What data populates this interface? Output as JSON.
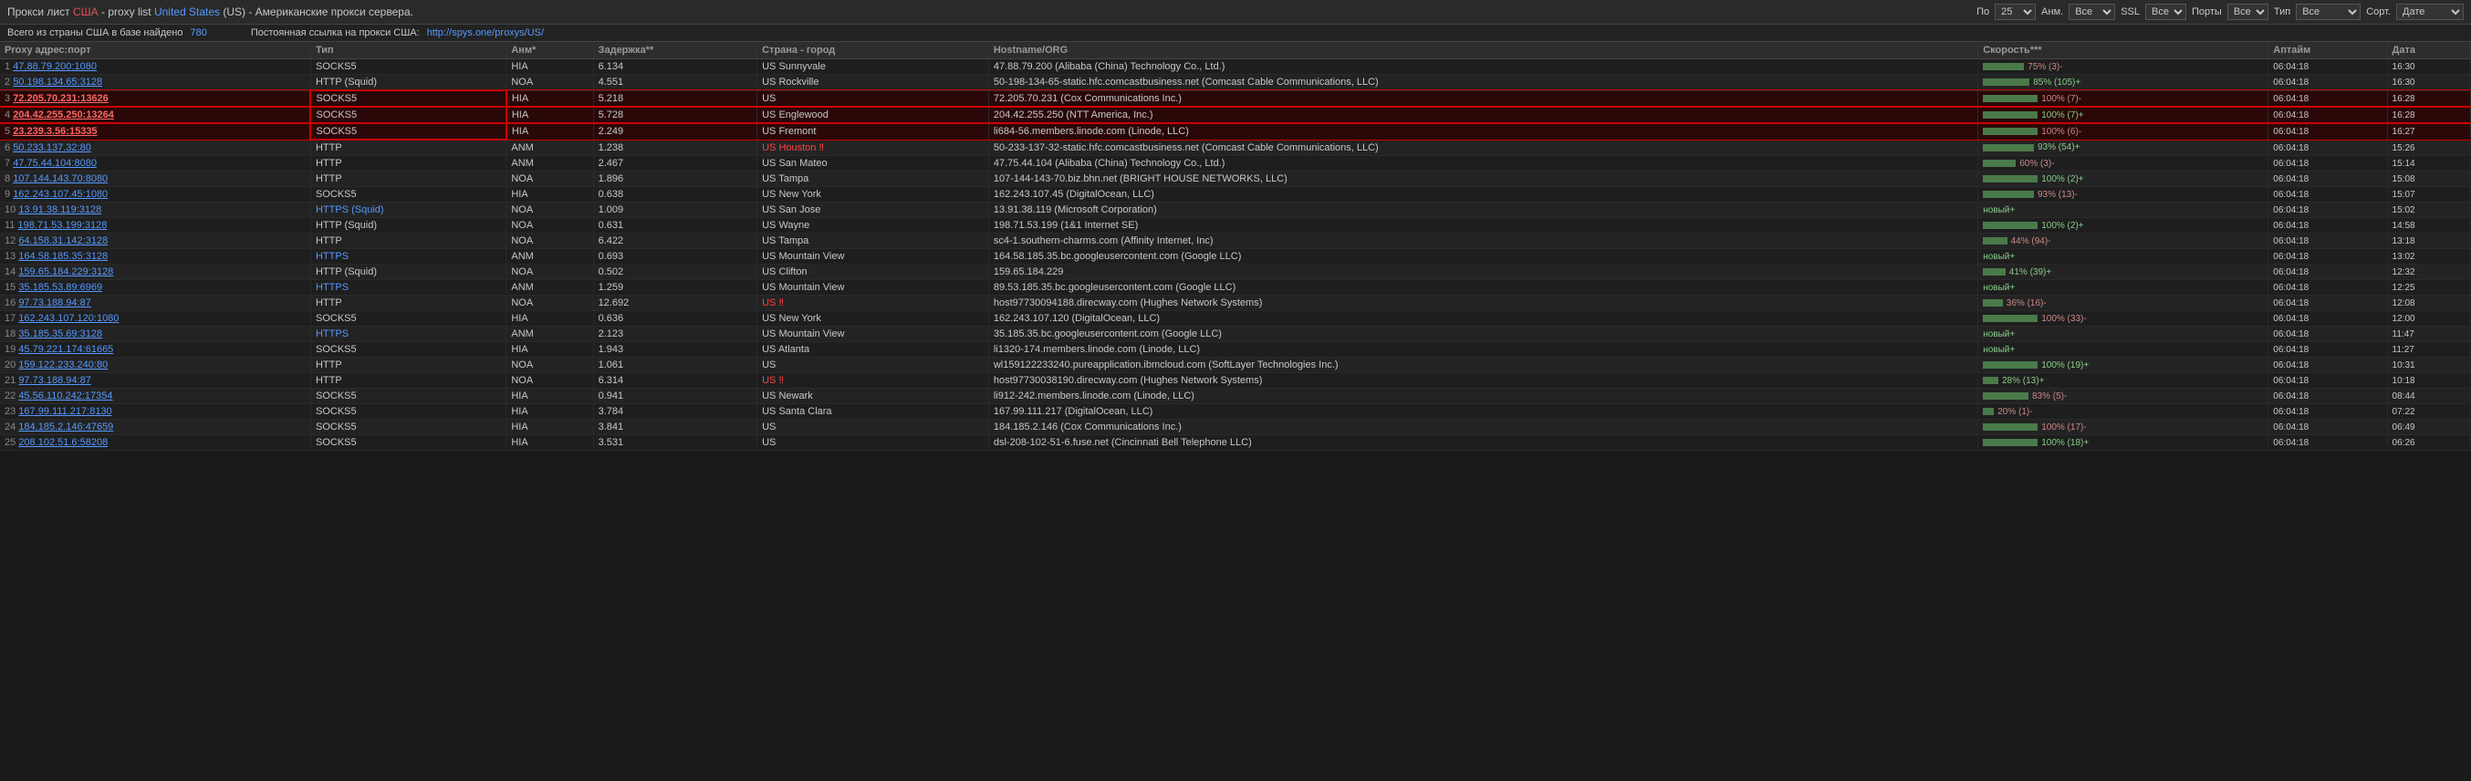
{
  "header": {
    "title": "Прокси лист ",
    "usa_label": "США",
    "dash": " - proxy list ",
    "us_label": "United States",
    "us_code": " (US)",
    "suffix": " - Американские прокси сервера.",
    "controls": {
      "po_label": "По",
      "anm_label": "Анм.",
      "ssl_label": "SSL",
      "ports_label": "Порты",
      "type_label": "Тип",
      "sort_label": "Сорт.",
      "per_page": "25",
      "anm_value": "Все",
      "ssl_value": "Все",
      "ports_value": "Все",
      "type_value": "Все",
      "sort_value": "Дате"
    }
  },
  "subbar": {
    "text": "Всего из страны США в базе найдено ",
    "count": "780",
    "permalink_text": "Постоянная ссылка на прокси США: ",
    "permalink_url": "http://spys.one/proxys/US/"
  },
  "table": {
    "columns": [
      "Proxy адрес:порт",
      "Тип",
      "Анм*",
      "Задержка**",
      "Страна - город",
      "Hostname/ORG",
      "Скорость***",
      "Аптайм",
      "Дата"
    ],
    "rows": [
      {
        "num": "1",
        "ip": "47.88.79.200:1080",
        "type": "SOCKS5",
        "anm": "HIA",
        "delay": "6.134",
        "country": "US Sunnyvale",
        "hostname": "47.88.79.200 (Alibaba (China) Technology Co., Ltd.)",
        "speed": 75,
        "speed_text": "75% (3)-",
        "uptime": "06:04:18",
        "date": "16:30",
        "highlighted": false,
        "country_red": false
      },
      {
        "num": "2",
        "ip": "50.198.134.65:3128",
        "type": "HTTP (Squid)",
        "anm": "NOA",
        "delay": "4.551",
        "country": "US Rockville",
        "hostname": "50-198-134-65-static.hfc.comcastbusiness.net (Comcast Cable Communications, LLC)",
        "speed": 85,
        "speed_text": "85% (105)+",
        "uptime": "06:04:18",
        "date": "16:30",
        "highlighted": false,
        "country_red": false
      },
      {
        "num": "3",
        "ip": "72.205.70.231:13626",
        "type": "SOCKS5",
        "anm": "HIA",
        "delay": "5.218",
        "country": "US",
        "hostname": "72.205.70.231 (Cox Communications Inc.)",
        "speed": 100,
        "speed_text": "100% (7)-",
        "uptime": "06:04:18",
        "date": "16:28",
        "highlighted": true,
        "country_red": false
      },
      {
        "num": "4",
        "ip": "204.42.255.250:13264",
        "type": "SOCKS5",
        "anm": "HIA",
        "delay": "5.728",
        "country": "US Englewood",
        "hostname": "204.42.255.250 (NTT America, Inc.)",
        "speed": 100,
        "speed_text": "100% (7)+",
        "uptime": "06:04:18",
        "date": "16:28",
        "highlighted": true,
        "country_red": false
      },
      {
        "num": "5",
        "ip": "23.239.3.56:15335",
        "type": "SOCKS5",
        "anm": "HIA",
        "delay": "2.249",
        "country": "US Fremont",
        "hostname": "li684-56.members.linode.com (Linode, LLC)",
        "speed": 100,
        "speed_text": "100% (6)-",
        "uptime": "06:04:18",
        "date": "16:27",
        "highlighted": true,
        "country_red": false
      },
      {
        "num": "6",
        "ip": "50.233.137.32:80",
        "type": "HTTP",
        "anm": "ANM",
        "delay": "1.238",
        "country": "US Houston ‼",
        "hostname": "50-233-137-32-static.hfc.comcastbusiness.net (Comcast Cable Communications, LLC)",
        "speed": 93,
        "speed_text": "93% (54)+",
        "uptime": "06:04:18",
        "date": "15:26",
        "highlighted": false,
        "country_red": true
      },
      {
        "num": "7",
        "ip": "47.75.44.104:8080",
        "type": "HTTP",
        "anm": "ANM",
        "delay": "2.467",
        "country": "US San Mateo",
        "hostname": "47.75.44.104 (Alibaba (China) Technology Co., Ltd.)",
        "speed": 60,
        "speed_text": "60% (3)-",
        "uptime": "06:04:18",
        "date": "15:14",
        "highlighted": false,
        "country_red": false
      },
      {
        "num": "8",
        "ip": "107.144.143.70:8080",
        "type": "HTTP",
        "anm": "NOA",
        "delay": "1.896",
        "country": "US Tampa",
        "hostname": "107-144-143-70.biz.bhn.net (BRIGHT HOUSE NETWORKS, LLC)",
        "speed": 100,
        "speed_text": "100% (2)+",
        "uptime": "06:04:18",
        "date": "15:08",
        "highlighted": false,
        "country_red": false
      },
      {
        "num": "9",
        "ip": "162.243.107.45:1080",
        "type": "SOCKS5",
        "anm": "HIA",
        "delay": "0.638",
        "country": "US New York",
        "hostname": "162.243.107.45 (DigitalOcean, LLC)",
        "speed": 93,
        "speed_text": "93% (13)-",
        "uptime": "06:04:18",
        "date": "15:07",
        "highlighted": false,
        "country_red": false
      },
      {
        "num": "10",
        "ip": "13.91.38.119:3128",
        "type": "HTTPS (Squid)",
        "anm": "NOA",
        "delay": "1.009",
        "country": "US San Jose",
        "hostname": "13.91.38.119 (Microsoft Corporation)",
        "speed": 0,
        "speed_text": "новый+",
        "uptime": "06:04:18",
        "date": "15:02",
        "highlighted": false,
        "country_red": false
      },
      {
        "num": "11",
        "ip": "198.71.53.199:3128",
        "type": "HTTP (Squid)",
        "anm": "NOA",
        "delay": "0.631",
        "country": "US Wayne",
        "hostname": "198.71.53.199 (1&1 Internet SE)",
        "speed": 100,
        "speed_text": "100% (2)+",
        "uptime": "06:04:18",
        "date": "14:58",
        "highlighted": false,
        "country_red": false
      },
      {
        "num": "12",
        "ip": "64.158.31.142:3128",
        "type": "HTTP",
        "anm": "NOA",
        "delay": "6.422",
        "country": "US Tampa",
        "hostname": "sc4-1.southern-charms.com (Affinity Internet, Inc)",
        "speed": 44,
        "speed_text": "44% (94)-",
        "uptime": "06:04:18",
        "date": "13:18",
        "highlighted": false,
        "country_red": false
      },
      {
        "num": "13",
        "ip": "164.58.185.35:3128",
        "type": "HTTPS",
        "anm": "ANM",
        "delay": "0.693",
        "country": "US Mountain View",
        "hostname": "164.58.185.35.bc.googleusercontent.com (Google LLC)",
        "speed": 0,
        "speed_text": "новый+",
        "uptime": "06:04:18",
        "date": "13:02",
        "highlighted": false,
        "country_red": false
      },
      {
        "num": "14",
        "ip": "159.65.184.229:3128",
        "type": "HTTP (Squid)",
        "anm": "NOA",
        "delay": "0.502",
        "country": "US Clifton",
        "hostname": "159.65.184.229",
        "speed": 41,
        "speed_text": "41% (39)+",
        "uptime": "06:04:18",
        "date": "12:32",
        "highlighted": false,
        "country_red": false
      },
      {
        "num": "15",
        "ip": "35.185.53.89:6969",
        "type": "HTTPS",
        "anm": "ANM",
        "delay": "1.259",
        "country": "US Mountain View",
        "hostname": "89.53.185.35.bc.googleusercontent.com (Google LLC)",
        "speed": 0,
        "speed_text": "новый+",
        "uptime": "06:04:18",
        "date": "12:25",
        "highlighted": false,
        "country_red": false
      },
      {
        "num": "16",
        "ip": "97.73.188.94:87",
        "type": "HTTP",
        "anm": "NOA",
        "delay": "12.692",
        "country": "US ‼",
        "hostname": "host97730094188.direcway.com (Hughes Network Systems)",
        "speed": 36,
        "speed_text": "36% (16)-",
        "uptime": "06:04:18",
        "date": "12:08",
        "highlighted": false,
        "country_red": true
      },
      {
        "num": "17",
        "ip": "162.243.107.120:1080",
        "type": "SOCKS5",
        "anm": "HIA",
        "delay": "0.636",
        "country": "US New York",
        "hostname": "162.243.107.120 (DigitalOcean, LLC)",
        "speed": 100,
        "speed_text": "100% (33)-",
        "uptime": "06:04:18",
        "date": "12:00",
        "highlighted": false,
        "country_red": false
      },
      {
        "num": "18",
        "ip": "35.185.35.69:3128",
        "type": "HTTPS",
        "anm": "ANM",
        "delay": "2.123",
        "country": "US Mountain View",
        "hostname": "35.185.35.bc.googleusercontent.com (Google LLC)",
        "speed": 0,
        "speed_text": "новый+",
        "uptime": "06:04:18",
        "date": "11:47",
        "highlighted": false,
        "country_red": false
      },
      {
        "num": "19",
        "ip": "45.79.221.174:61665",
        "type": "SOCKS5",
        "anm": "HIA",
        "delay": "1.943",
        "country": "US Atlanta",
        "hostname": "li1320-174.members.linode.com (Linode, LLC)",
        "speed": 0,
        "speed_text": "новый+",
        "uptime": "06:04:18",
        "date": "11:27",
        "highlighted": false,
        "country_red": false
      },
      {
        "num": "20",
        "ip": "159.122.233.240:80",
        "type": "HTTP",
        "anm": "NOA",
        "delay": "1.061",
        "country": "US",
        "hostname": "wl159122233240.pureapplication.ibmcloud.com (SoftLayer Technologies Inc.)",
        "speed": 100,
        "speed_text": "100% (19)+",
        "uptime": "06:04:18",
        "date": "10:31",
        "highlighted": false,
        "country_red": false
      },
      {
        "num": "21",
        "ip": "97.73.188.94:87",
        "type": "HTTP",
        "anm": "NOA",
        "delay": "6.314",
        "country": "US ‼",
        "hostname": "host97730038190.direcway.com (Hughes Network Systems)",
        "speed": 28,
        "speed_text": "28% (13)+",
        "uptime": "06:04:18",
        "date": "10:18",
        "highlighted": false,
        "country_red": true
      },
      {
        "num": "22",
        "ip": "45.56.110.242:17354",
        "type": "SOCKS5",
        "anm": "HIA",
        "delay": "0.941",
        "country": "US Newark",
        "hostname": "li912-242.members.linode.com (Linode, LLC)",
        "speed": 83,
        "speed_text": "83% (5)-",
        "uptime": "06:04:18",
        "date": "08:44",
        "highlighted": false,
        "country_red": false
      },
      {
        "num": "23",
        "ip": "167.99.111.217:8130",
        "type": "SOCKS5",
        "anm": "HIA",
        "delay": "3.784",
        "country": "US Santa Clara",
        "hostname": "167.99.111.217 (DigitalOcean, LLC)",
        "speed": 20,
        "speed_text": "20% (1)-",
        "uptime": "06:04:18",
        "date": "07:22",
        "highlighted": false,
        "country_red": false
      },
      {
        "num": "24",
        "ip": "184.185.2.146:47659",
        "type": "SOCKS5",
        "anm": "HIA",
        "delay": "3.841",
        "country": "US",
        "hostname": "184.185.2.146 (Cox Communications Inc.)",
        "speed": 100,
        "speed_text": "100% (17)-",
        "uptime": "06:04:18",
        "date": "06:49",
        "highlighted": false,
        "country_red": false
      },
      {
        "num": "25",
        "ip": "208.102.51.6:58208",
        "type": "SOCKS5",
        "anm": "HIA",
        "delay": "3.531",
        "country": "US",
        "hostname": "dsl-208-102-51-6.fuse.net (Cincinnati Bell Telephone LLC)",
        "speed": 100,
        "speed_text": "100% (18)+",
        "uptime": "06:04:18",
        "date": "06:26",
        "highlighted": false,
        "country_red": false
      }
    ]
  }
}
